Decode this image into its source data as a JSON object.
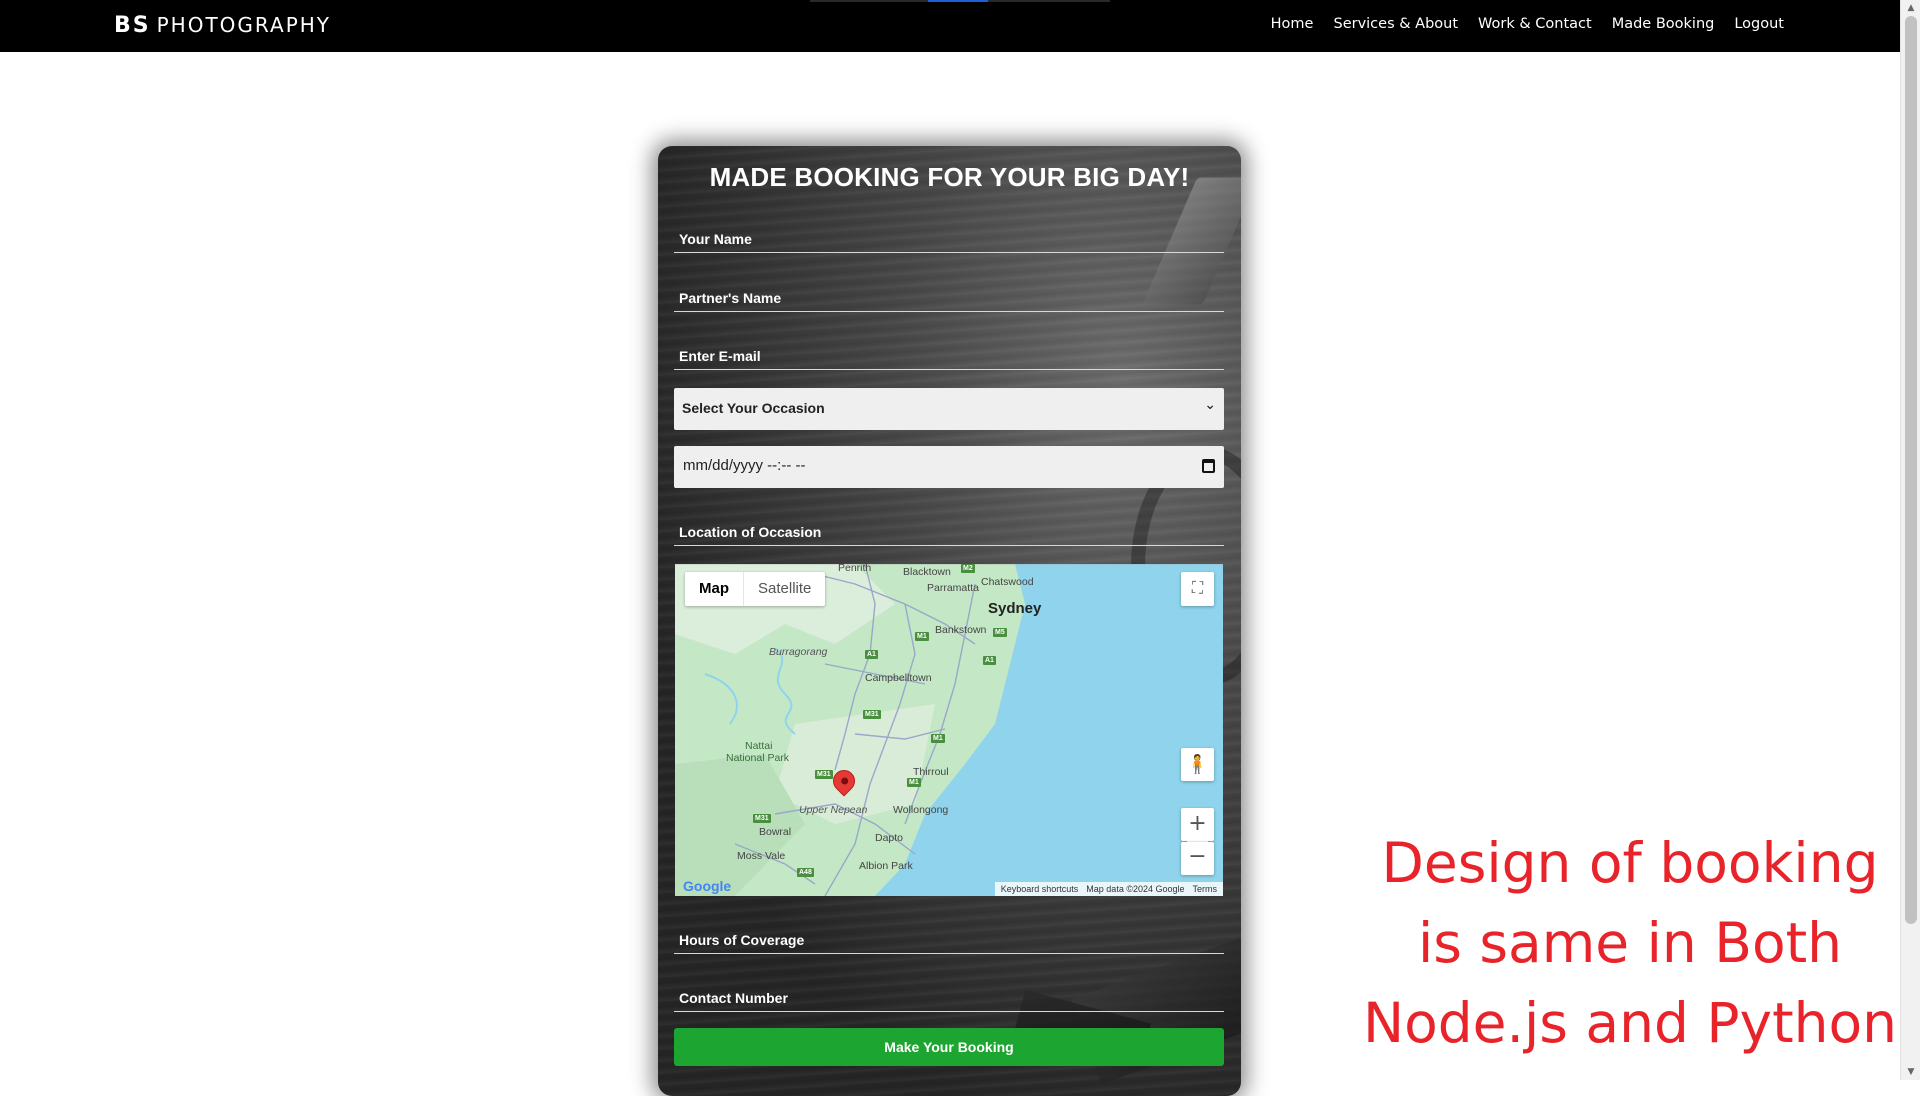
{
  "navbar": {
    "brand_bold": "BS",
    "brand_rest": "PHOTOGRAPHY",
    "links": [
      "Home",
      "Services & About",
      "Work & Contact",
      "Made Booking",
      "Logout"
    ]
  },
  "form": {
    "title": "MADE BOOKING FOR YOUR BIG DAY!",
    "name_placeholder": "Your Name",
    "partner_placeholder": "Partner's Name",
    "email_placeholder": "Enter E-mail",
    "occasion_selected": "Select Your Occasion",
    "datetime_value": "mm/dd/yyyy --:-- --",
    "location_placeholder": "Location of Occasion",
    "hours_placeholder": "Hours of Coverage",
    "contact_placeholder": "Contact Number",
    "submit_label": "Make Your Booking"
  },
  "map": {
    "tab_map": "Map",
    "tab_satellite": "Satellite",
    "labels": {
      "sydney": "Sydney",
      "penrith": "Penrith",
      "blacktown": "Blacktown",
      "parramatta": "Parramatta",
      "chatswood": "Chatswood",
      "bankstown": "Bankstown",
      "burragorang": "Burragorang",
      "campbelltown": "Campbelltown",
      "nattai": "Nattai",
      "nattai2": "National Park",
      "thirroul": "Thirroul",
      "upper_nepean": "Upper Nepean",
      "wollongong": "Wollongong",
      "bowral": "Bowral",
      "dapto": "Dapto",
      "moss_vale": "Moss Vale",
      "albion_park": "Albion Park"
    },
    "shields": [
      "M2",
      "M1",
      "M5",
      "A1",
      "A1",
      "M31",
      "M1",
      "M31",
      "M1",
      "M31",
      "A48"
    ],
    "google_logo": "Google",
    "footer_shortcuts": "Keyboard shortcuts",
    "footer_data": "Map data ©2024 Google",
    "footer_terms": "Terms",
    "colors": {
      "land": "#c4e8c6",
      "water": "#8fd4ec",
      "road": "#9aa7c9",
      "marker": "#e53935"
    }
  },
  "annotation": {
    "line1": "Design of booking",
    "line2": "is same in Both",
    "line3": "Node.js and Python"
  }
}
